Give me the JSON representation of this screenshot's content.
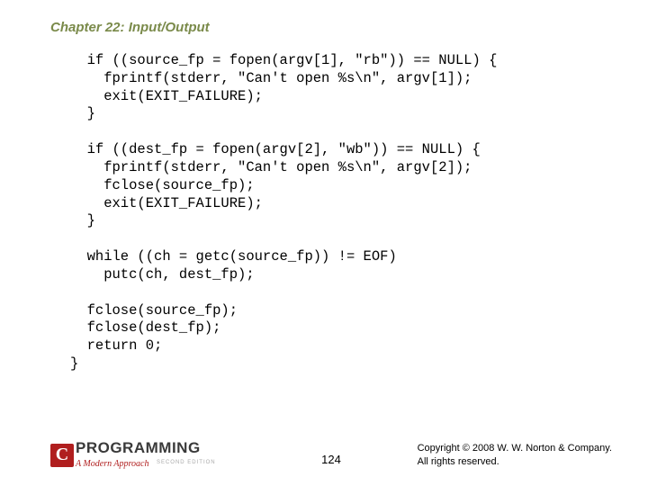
{
  "header": {
    "chapter_title": "Chapter 22: Input/Output"
  },
  "code": {
    "lines": "  if ((source_fp = fopen(argv[1], \"rb\")) == NULL) {\n    fprintf(stderr, \"Can't open %s\\n\", argv[1]);\n    exit(EXIT_FAILURE);\n  }\n\n  if ((dest_fp = fopen(argv[2], \"wb\")) == NULL) {\n    fprintf(stderr, \"Can't open %s\\n\", argv[2]);\n    fclose(source_fp);\n    exit(EXIT_FAILURE);\n  }\n\n  while ((ch = getc(source_fp)) != EOF)\n    putc(ch, dest_fp);\n\n  fclose(source_fp);\n  fclose(dest_fp);\n  return 0;\n}"
  },
  "footer": {
    "logo": {
      "c_glyph": "C",
      "main": "PROGRAMMING",
      "sub": "A Modern Approach",
      "edition": "SECOND EDITION"
    },
    "page_number": "124",
    "copyright_line1": "Copyright © 2008 W. W. Norton & Company.",
    "copyright_line2": "All rights reserved."
  }
}
